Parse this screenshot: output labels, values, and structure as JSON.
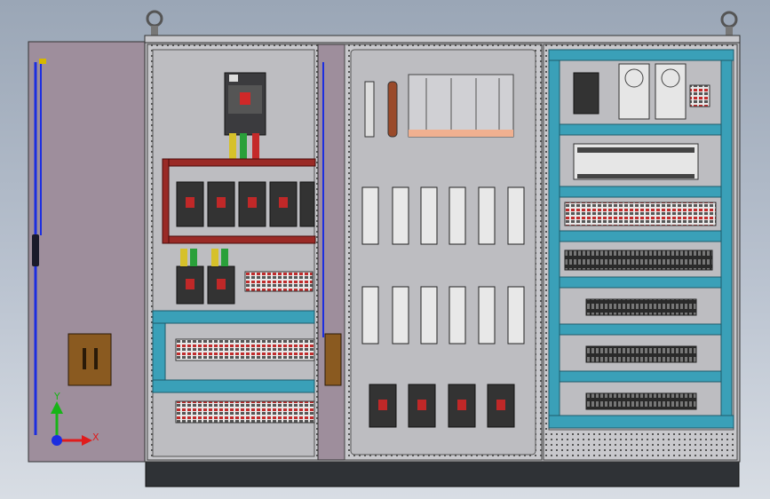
{
  "scene": {
    "background_top": "#9aa6b6",
    "background_bottom": "#d8dde4",
    "cabinet_body_color": "#b9b9bd",
    "door_color": "#9e8e9c",
    "rail_color": "#3aa0b8",
    "busbar_color": "#9a2a26",
    "plinth_color": "#2f3236"
  },
  "triad": {
    "x_label": "X",
    "y_label": "Y",
    "x_color": "#e01c1c",
    "y_color": "#18b418",
    "z_color": "#1c2ee0"
  }
}
